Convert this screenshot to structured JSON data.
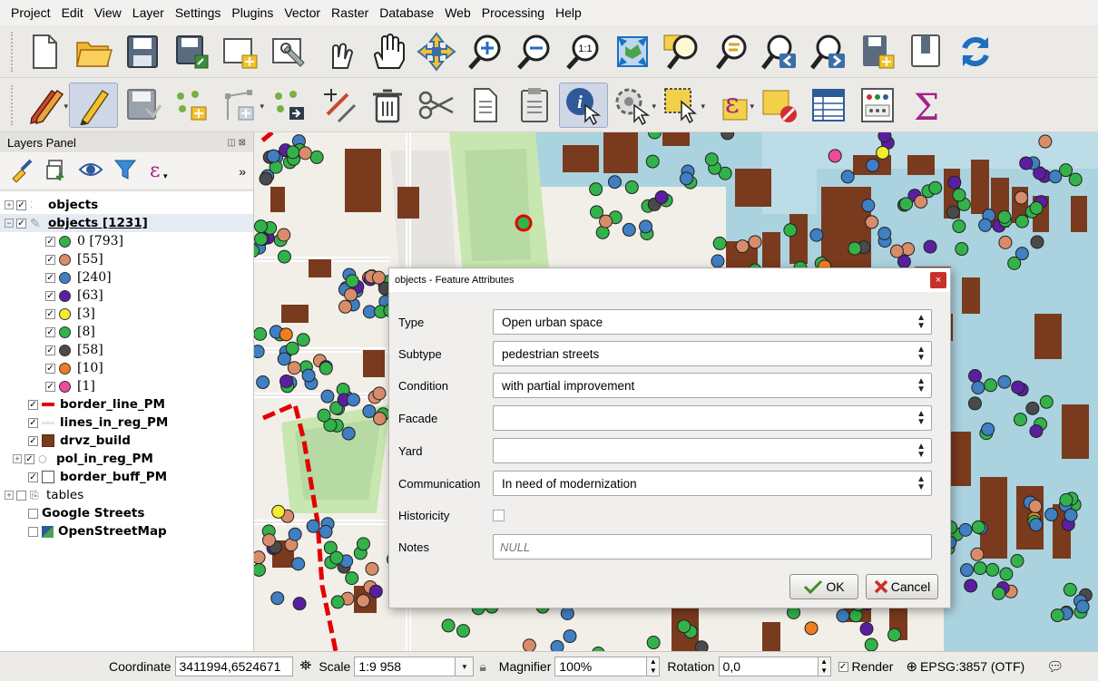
{
  "menu": [
    "Project",
    "Edit",
    "View",
    "Layer",
    "Settings",
    "Plugins",
    "Vector",
    "Raster",
    "Database",
    "Web",
    "Processing",
    "Help"
  ],
  "toolbar1": [
    "new-project-icon",
    "open-project-icon",
    "save-project-icon",
    "save-as-icon",
    "new-print-layout-icon",
    "layout-manager-icon",
    "touch-zoom-icon",
    "pan-hand-icon",
    "pan-to-selection-icon",
    "zoom-in-icon",
    "zoom-out-icon",
    "zoom-native-icon",
    "zoom-full-icon",
    "zoom-to-selection-icon",
    "zoom-to-layer-icon",
    "zoom-last-icon",
    "zoom-next-icon",
    "new-map-view-icon",
    "new-bookmark-icon",
    "refresh-icon"
  ],
  "toolbar2": [
    "current-edits-icon",
    "toggle-editing-icon",
    "save-edits-icon",
    "add-feature-icon",
    "vertex-tool-icon",
    "move-feature-icon",
    "node-tool-icon",
    "delete-selected-icon",
    "cut-features-icon",
    "copy-features-icon",
    "paste-features-icon",
    "identify-features-icon",
    "run-action-icon",
    "select-features-icon",
    "select-by-expression-icon",
    "deselect-all-icon",
    "open-attribute-table-icon",
    "field-calculator-icon",
    "statistics-summary-icon"
  ],
  "layers_panel": {
    "title": "Layers Panel",
    "header_buttons": "◫ ⊠",
    "more": "»",
    "layers": [
      {
        "name": "objects",
        "checked": true,
        "expander": "+",
        "type": "points-dim",
        "bold": true
      },
      {
        "name": "objects [1231]",
        "checked": true,
        "expander": "−",
        "type": "edit",
        "bold": true,
        "underline": true
      },
      {
        "label": "0 [793]",
        "color": "#33b24a",
        "class": true
      },
      {
        "label": "[55]",
        "color": "#d98c6a",
        "class": true
      },
      {
        "label": "[240]",
        "color": "#3f7fc2",
        "class": true
      },
      {
        "label": "[63]",
        "color": "#5a1fa1",
        "class": true
      },
      {
        "label": "[3]",
        "color": "#f4ec2e",
        "class": true
      },
      {
        "label": "[8]",
        "color": "#2fb34a",
        "class": true
      },
      {
        "label": "[58]",
        "color": "#4a4a4a",
        "class": true
      },
      {
        "label": "[10]",
        "color": "#f07e1e",
        "class": true
      },
      {
        "label": "[1]",
        "color": "#ef4a9c",
        "class": true
      },
      {
        "name": "border_line_PM",
        "checked": true,
        "type": "redline",
        "bold": true
      },
      {
        "name": "lines_in_reg_PM",
        "checked": true,
        "type": "greyline",
        "bold": true
      },
      {
        "name": "drvz_build",
        "checked": true,
        "type": "brown",
        "bold": true
      },
      {
        "name": "pol_in_reg_PM",
        "checked": true,
        "expander": "+",
        "type": "poly-icon",
        "bold": true
      },
      {
        "name": "border_buff_PM",
        "checked": true,
        "type": "empty-rect",
        "bold": true
      },
      {
        "name": "tables",
        "checked": false,
        "expander": "+",
        "type": "group",
        "bold": false
      },
      {
        "name": "Google Streets",
        "checked": false,
        "type": "none",
        "bold": true
      },
      {
        "name": "OpenStreetMap",
        "checked": false,
        "type": "osm",
        "bold": true
      }
    ]
  },
  "dialog": {
    "title": "objects - Feature Attributes",
    "close": "×",
    "fields": {
      "type": {
        "label": "Type",
        "value": "Open urban space"
      },
      "subtype": {
        "label": "Subtype",
        "value": "pedestrian streets"
      },
      "condition": {
        "label": "Condition",
        "value": "with partial improvement"
      },
      "facade": {
        "label": "Facade",
        "value": ""
      },
      "yard": {
        "label": "Yard",
        "value": ""
      },
      "communication": {
        "label": "Communication",
        "value": "In need of modernization"
      },
      "historicity": {
        "label": "Historicity",
        "checked": false
      },
      "notes": {
        "label": "Notes",
        "placeholder": "NULL"
      }
    },
    "ok_label": "OK",
    "cancel_label": "Cancel"
  },
  "statusbar": {
    "coordinate_label": "Coordinate",
    "coordinate_value": "3411994,6524671",
    "scale_label": "Scale",
    "scale_value": "1:9 958",
    "magnifier_label": "Magnifier",
    "magnifier_value": "100%",
    "rotation_label": "Rotation",
    "rotation_value": "0,0",
    "render_label": "Render",
    "render_checked": true,
    "crs": "EPSG:3857 (OTF)"
  },
  "colors": {
    "building": "#7a3a1e",
    "water": "#aad3df",
    "park": "#c8e6b0",
    "border": "#e30000"
  }
}
